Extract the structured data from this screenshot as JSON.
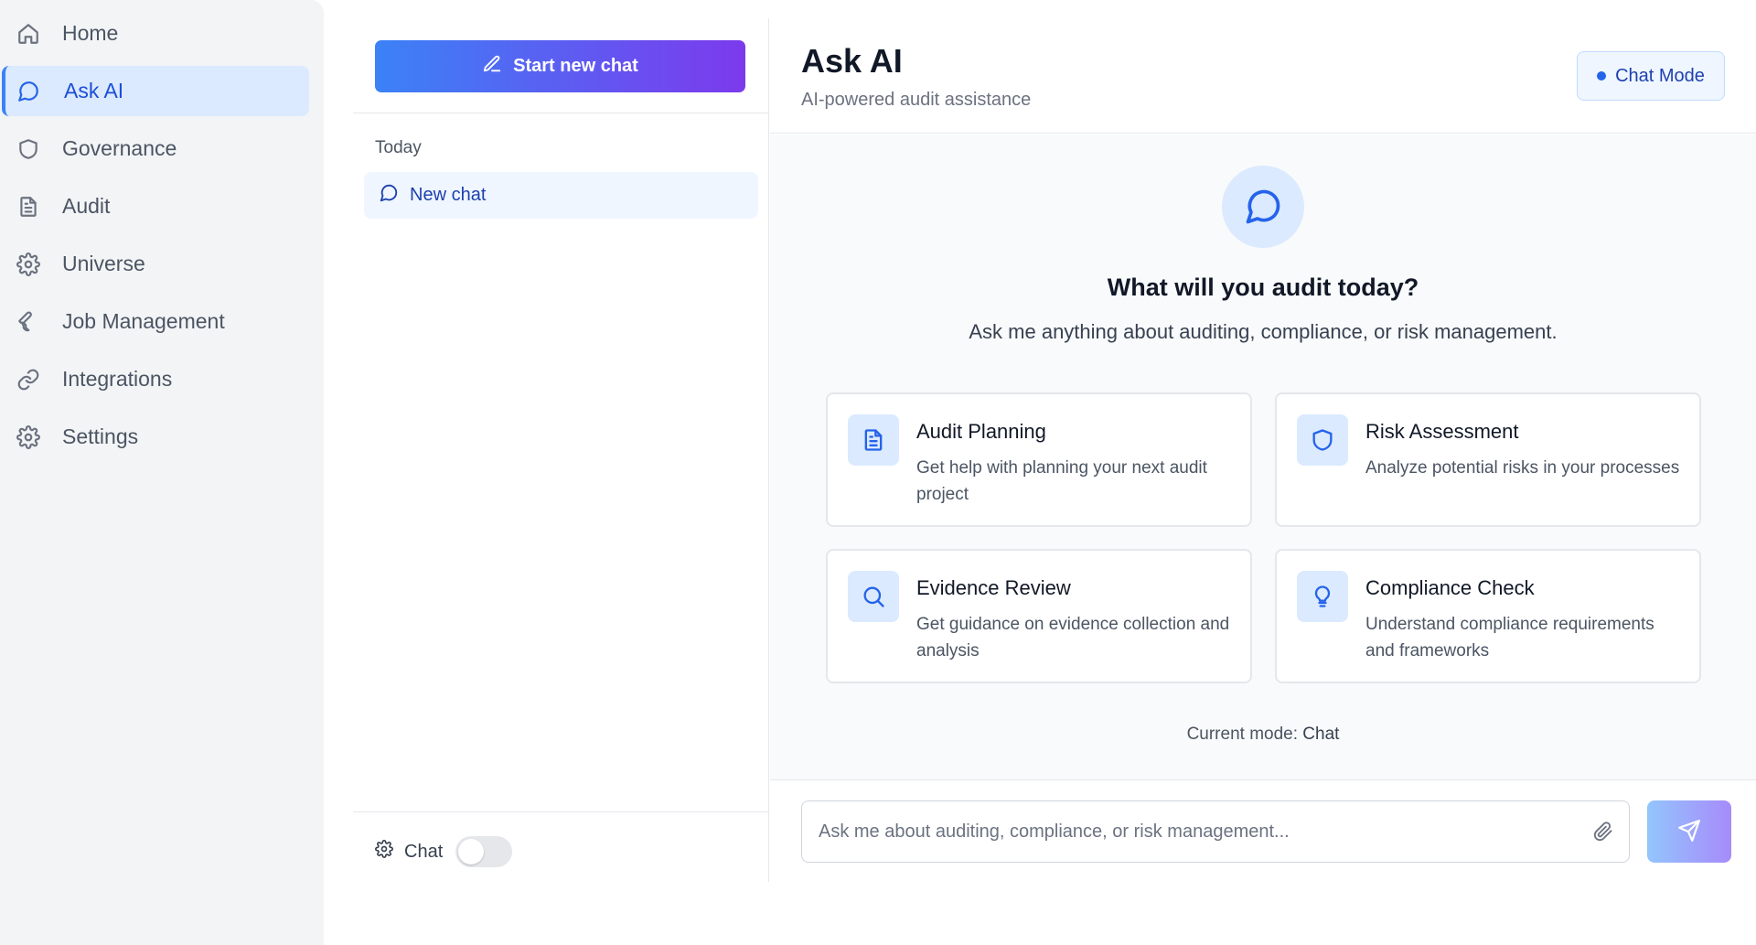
{
  "sidebar": {
    "items": [
      {
        "label": "Home",
        "icon": "home-icon"
      },
      {
        "label": "Ask AI",
        "icon": "message-circle-icon",
        "active": true
      },
      {
        "label": "Governance",
        "icon": "shield-icon"
      },
      {
        "label": "Audit",
        "icon": "file-text-icon"
      },
      {
        "label": "Universe",
        "icon": "gear-icon"
      },
      {
        "label": "Job Management",
        "icon": "wrench-icon"
      },
      {
        "label": "Integrations",
        "icon": "link-icon"
      },
      {
        "label": "Settings",
        "icon": "gear-icon"
      }
    ]
  },
  "chat_panel": {
    "new_chat_label": "Start new chat",
    "section_label": "Today",
    "chats": [
      {
        "label": "New chat"
      }
    ],
    "mode_toggle_label": "Chat",
    "mode_toggle_on": false
  },
  "header": {
    "title": "Ask AI",
    "subtitle": "AI-powered audit assistance",
    "mode_badge": "Chat Mode"
  },
  "hero": {
    "title": "What will you audit today?",
    "subtitle": "Ask me anything about auditing, compliance, or risk management."
  },
  "cards": [
    {
      "title": "Audit Planning",
      "desc": "Get help with planning your next audit project",
      "icon": "document-icon"
    },
    {
      "title": "Risk Assessment",
      "desc": "Analyze potential risks in your processes",
      "icon": "shield-icon"
    },
    {
      "title": "Evidence Review",
      "desc": "Get guidance on evidence collection and analysis",
      "icon": "search-icon"
    },
    {
      "title": "Compliance Check",
      "desc": "Understand compliance requirements and frameworks",
      "icon": "lightbulb-icon"
    }
  ],
  "status": {
    "mode_prefix": "Current mode:",
    "mode_value": "Chat"
  },
  "composer": {
    "placeholder": "Ask me about auditing, compliance, or risk management...",
    "value": ""
  },
  "colors": {
    "accent": "#3b82f6",
    "gradient_start": "#3b82f6",
    "gradient_end": "#7c3aed",
    "active_bg": "#dbeafe"
  }
}
